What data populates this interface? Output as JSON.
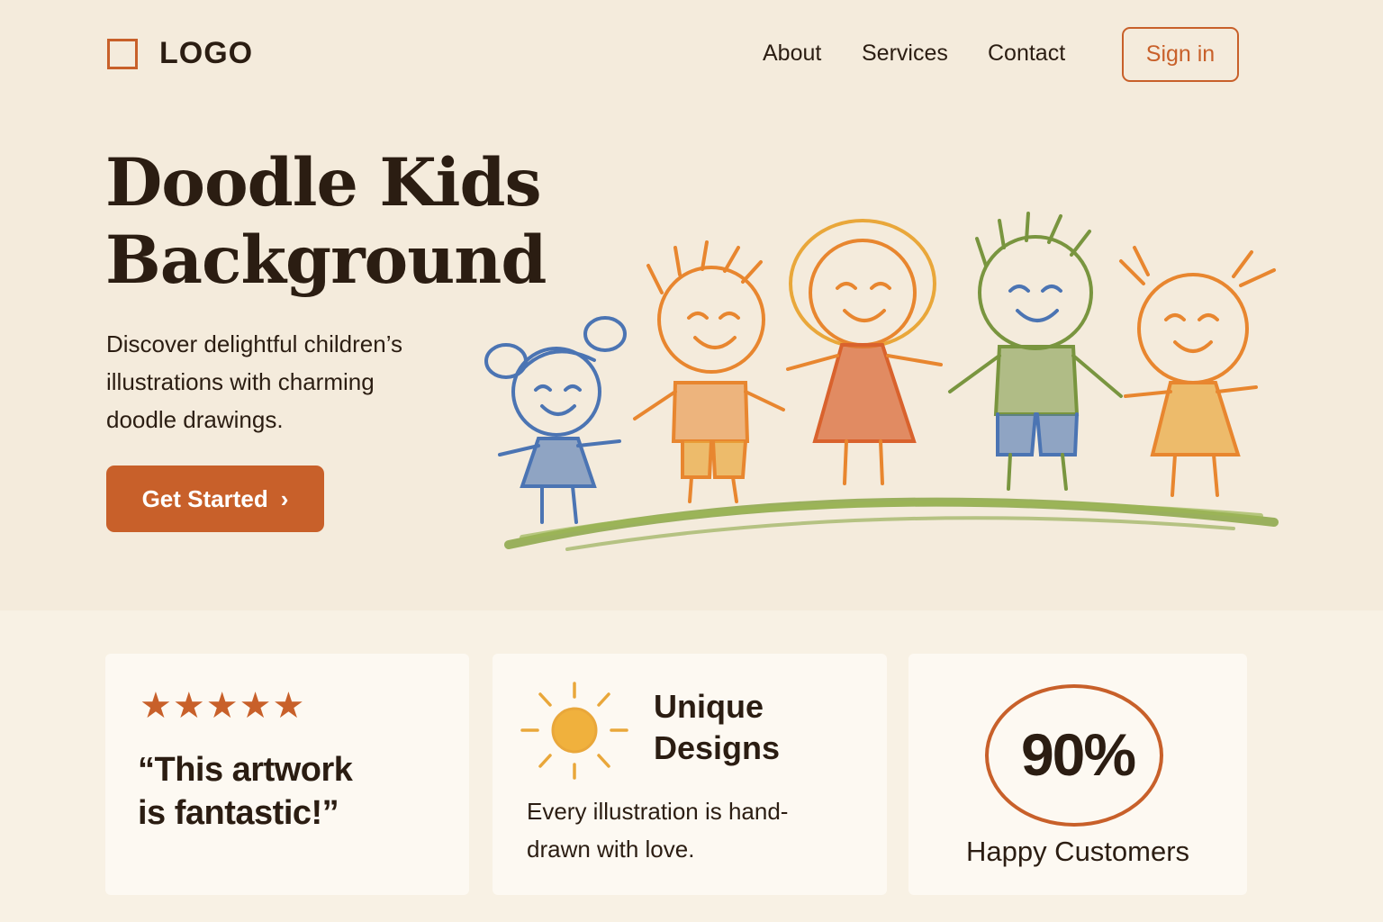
{
  "header": {
    "logo_text": "LOGO",
    "nav": [
      {
        "label": "About"
      },
      {
        "label": "Services"
      },
      {
        "label": "Contact"
      }
    ],
    "signin_label": "Sign in"
  },
  "hero": {
    "title_line1": "Doodle Kids",
    "title_line2": "Background",
    "subtitle": "Discover delightful children’s illustrations with charming doodle drawings.",
    "cta_label": "Get Started",
    "illustration": "five hand-drawn crayon children standing on green grass"
  },
  "cards": {
    "testimonial": {
      "rating_stars": 5,
      "quote_line1": "“This artwork",
      "quote_line2": "is fantastic!”"
    },
    "feature": {
      "icon": "sun-icon",
      "title_line1": "Unique",
      "title_line2": "Designs",
      "body": "Every illustration is hand-drawn with love."
    },
    "stat": {
      "value": "90%",
      "label": "Happy Customers"
    }
  },
  "colors": {
    "accent": "#c8602a",
    "background": "#f4ebdc",
    "text": "#2b1d12",
    "kid_blue": "#4b74b3",
    "kid_orange": "#e8862f",
    "kid_green": "#79953f",
    "kid_yellow": "#e9a73a"
  }
}
